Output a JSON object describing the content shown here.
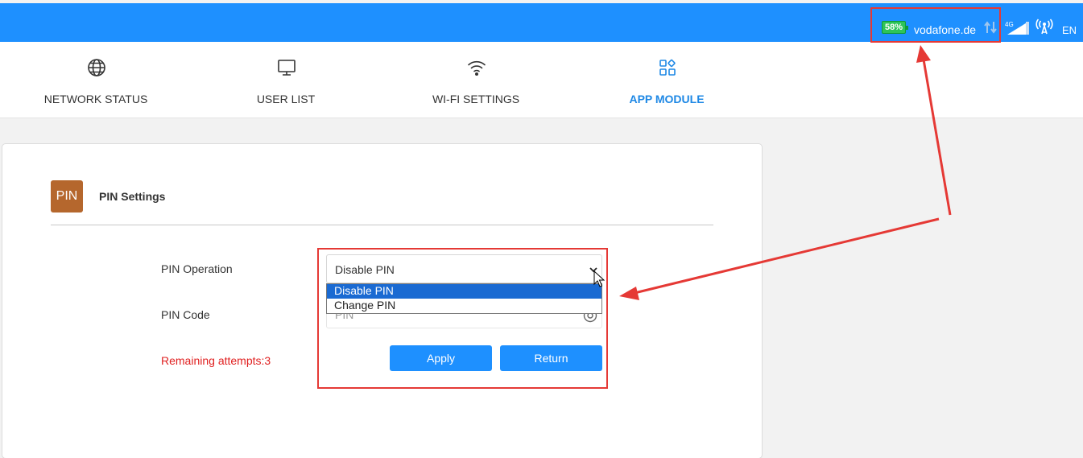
{
  "colors": {
    "topbar": "#1e90ff",
    "accent": "#1e88e5",
    "battery": "#2ec45a",
    "pin_badge": "#b5672d",
    "warning": "#e02020",
    "annotation": "#e53935"
  },
  "status_bar": {
    "battery": "58%",
    "operator": "vodafone.de",
    "network_type": "4G",
    "language": "EN"
  },
  "nav": {
    "items": [
      {
        "label": "NETWORK STATUS",
        "icon": "globe-icon"
      },
      {
        "label": "USER LIST",
        "icon": "monitor-icon"
      },
      {
        "label": "WI-FI SETTINGS",
        "icon": "wifi-icon"
      },
      {
        "label": "APP MODULE",
        "icon": "apps-icon",
        "active": true
      }
    ]
  },
  "card": {
    "badge": "PIN",
    "title": "PIN Settings"
  },
  "form": {
    "operation_label": "PIN Operation",
    "operation_value": "Disable PIN",
    "code_label": "PIN Code",
    "code_placeholder": "PIN",
    "remaining": "Remaining attempts:3",
    "options": [
      "Disable PIN",
      "Change PIN"
    ],
    "selected_option": "Disable PIN",
    "apply_label": "Apply",
    "return_label": "Return"
  }
}
